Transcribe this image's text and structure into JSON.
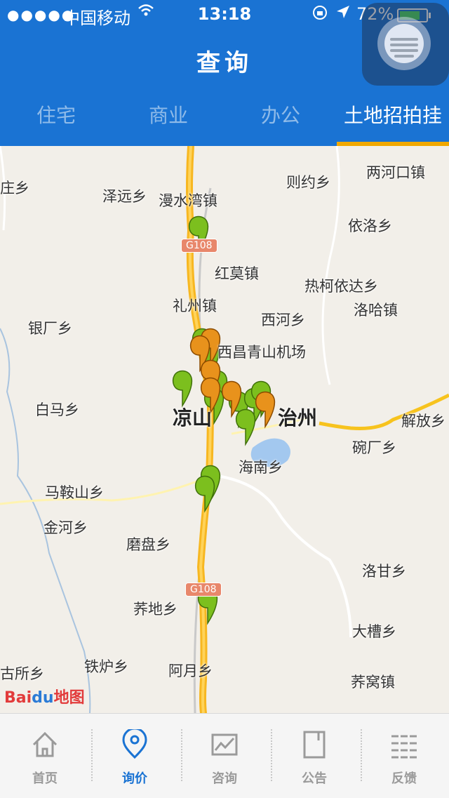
{
  "status_bar": {
    "signal": "●●●●●",
    "carrier": "中国移动",
    "wifi_icon": "wifi-icon",
    "time": "13:18",
    "battery_percent": "72%",
    "battery_level": 0.72
  },
  "nav": {
    "title": "查询"
  },
  "tabs": [
    {
      "label": "住宅",
      "active": false
    },
    {
      "label": "商业",
      "active": false
    },
    {
      "label": "办公",
      "active": false
    },
    {
      "label": "土地招拍挂",
      "active": true
    }
  ],
  "map": {
    "labels": [
      "两河口镇",
      "则约乡",
      "庄乡",
      "泽远乡",
      "漫水湾镇",
      "依洛乡",
      "红莫镇",
      "热柯依达乡",
      "礼州镇",
      "洛哈镇",
      "西河乡",
      "银厂乡",
      "西昌青山机场",
      "白马乡",
      "凉山",
      "治州",
      "解放乡",
      "碗厂乡",
      "海南乡",
      "马鞍山乡",
      "金河乡",
      "磨盘乡",
      "洛甘乡",
      "荞地乡",
      "大槽乡",
      "古所乡",
      "铁炉乡",
      "阿月乡",
      "荞窝镇"
    ],
    "road_shields": [
      "G108",
      "G108"
    ],
    "logo": {
      "part1": "Bai",
      "part2": "du",
      "part3": "地图"
    }
  },
  "bottom_nav": [
    {
      "label": "首页",
      "icon": "home-icon",
      "active": false
    },
    {
      "label": "询价",
      "icon": "location-pin-icon",
      "active": true
    },
    {
      "label": "咨询",
      "icon": "chart-icon",
      "active": false
    },
    {
      "label": "公告",
      "icon": "document-icon",
      "active": false
    },
    {
      "label": "反馈",
      "icon": "feedback-icon",
      "active": false
    }
  ],
  "colors": {
    "primary": "#1a73d3",
    "accent": "#f0a800",
    "marker_green": "#7cbf1e",
    "marker_orange": "#e8921c"
  }
}
